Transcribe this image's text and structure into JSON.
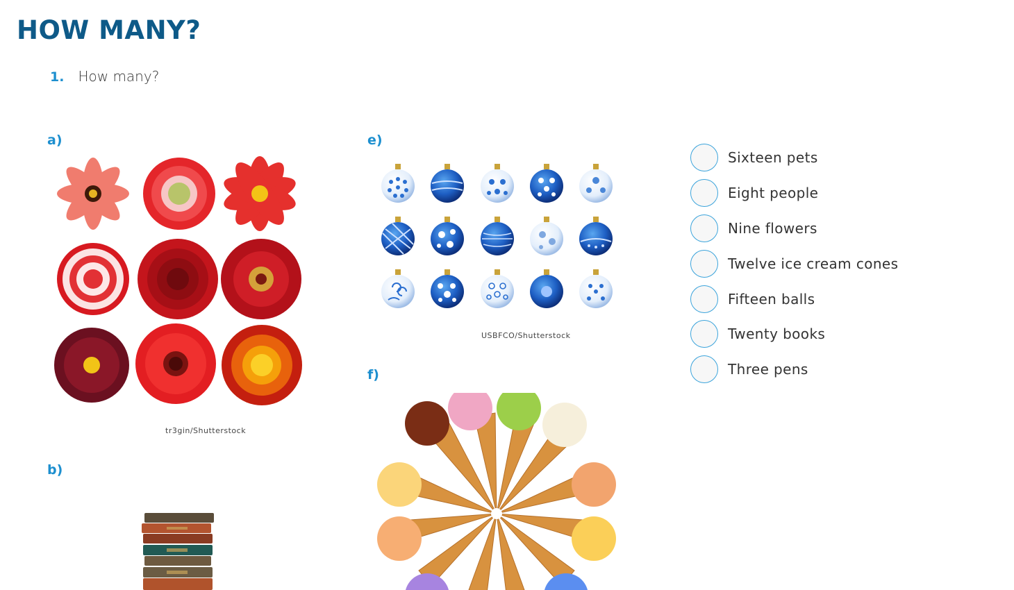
{
  "title": "HOW MANY?",
  "exercise": {
    "number": "1.",
    "prompt": "How many?"
  },
  "items": {
    "a": {
      "letter": "a)",
      "credit": "tr3gin/Shutterstock",
      "image": "red-flowers-grid"
    },
    "b": {
      "letter": "b)",
      "image": "stack-of-books"
    },
    "e": {
      "letter": "e)",
      "credit": "USBFCO/Shutterstock",
      "image": "blue-christmas-ornaments-grid"
    },
    "f": {
      "letter": "f)",
      "image": "ice-cream-cones-circle"
    }
  },
  "options": [
    {
      "label": "Sixteen pets"
    },
    {
      "label": "Eight people"
    },
    {
      "label": "Nine flowers"
    },
    {
      "label": "Twelve ice cream cones"
    },
    {
      "label": "Fifteen balls"
    },
    {
      "label": "Twenty books"
    },
    {
      "label": "Three pens"
    }
  ],
  "colors": {
    "title": "#0e5a88",
    "accent": "#1d8fcf",
    "radio_border": "#3aa3db"
  }
}
